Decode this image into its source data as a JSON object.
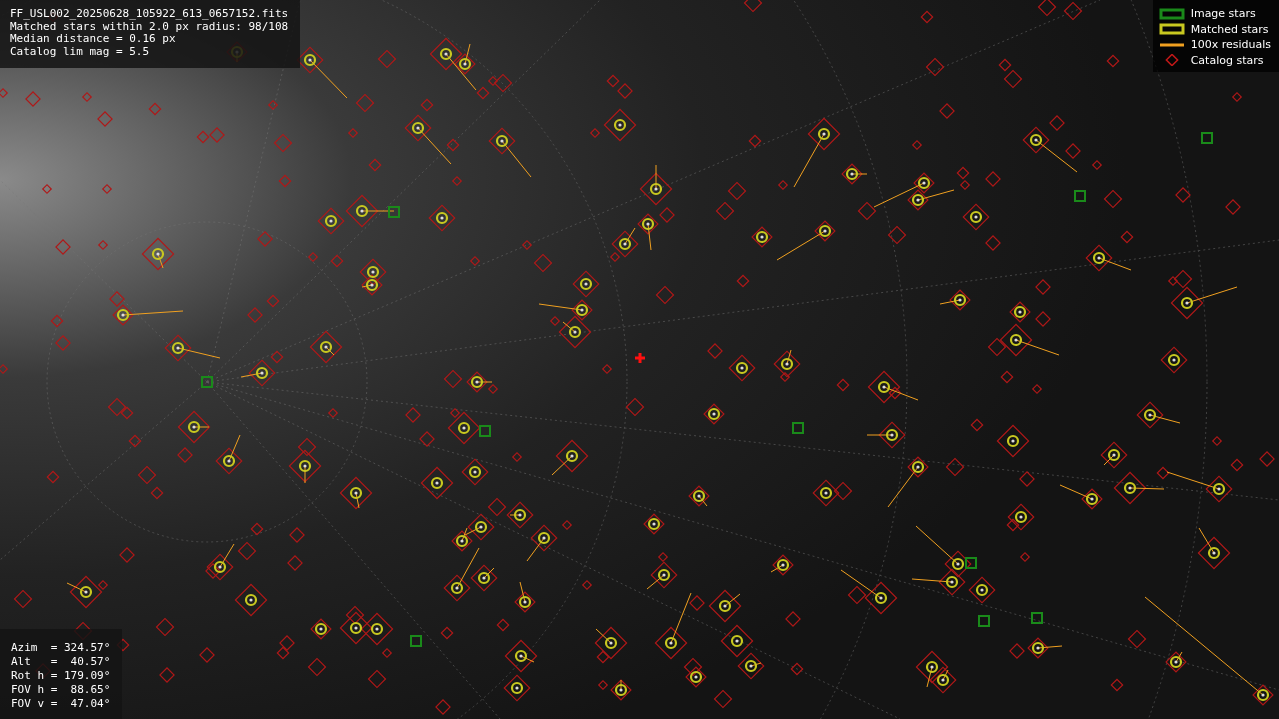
{
  "info_panel": {
    "lines": [
      "FF_USL002_20250628_105922_613_0657152.fits",
      "Matched stars within 2.0 px radius: 98/108",
      "Median distance = 0.16 px",
      "Catalog lim mag = 5.5"
    ]
  },
  "legend": [
    {
      "kind": "image",
      "label": "Image stars",
      "color": "#1a8a1a"
    },
    {
      "kind": "matched",
      "label": "Matched stars",
      "color": "#c8c820"
    },
    {
      "kind": "residual",
      "label": "100x residuals",
      "color": "#f0a020"
    },
    {
      "kind": "catalog",
      "label": "Catalog stars",
      "color": "#c01818"
    }
  ],
  "pointing_panel": {
    "lines": [
      "Azim  = 324.57°",
      "Alt   =  40.57°",
      "Rot h = 179.09°",
      "FOV h =  88.65°",
      "FOV v =  47.04°"
    ]
  }
}
